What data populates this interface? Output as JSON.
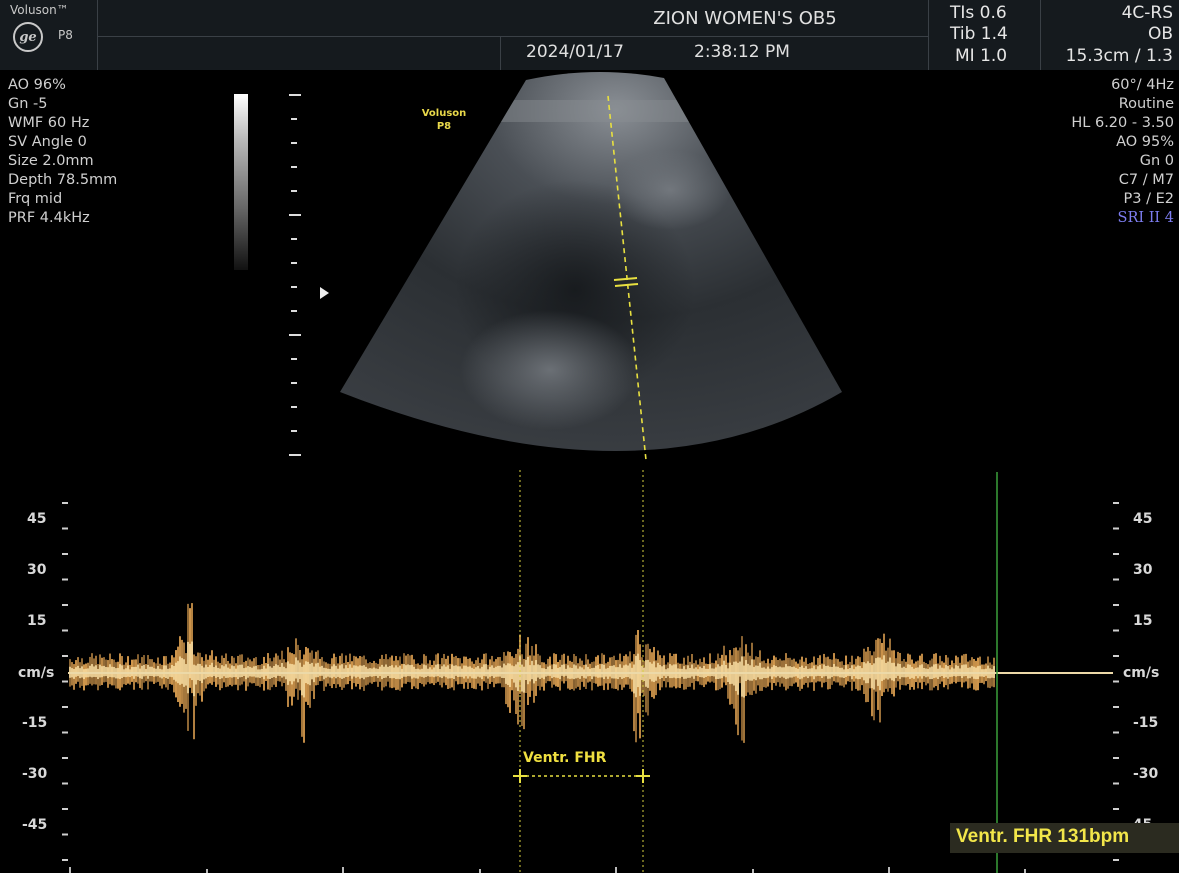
{
  "header": {
    "brand": "Voluson™",
    "probe": "P8",
    "institution": "ZION WOMEN'S OB5",
    "date": "2024/01/17",
    "time": "2:38:12 PM",
    "tis": "TIs 0.6",
    "tib": "Tib 1.4",
    "mi": "MI 1.0",
    "mode": "4C-RS",
    "preset": "OB",
    "depth_freq": "15.3cm / 1.3"
  },
  "left_params": [
    "AO 96%",
    "Gn -5",
    "WMF 60 Hz",
    "SV Angle 0",
    "Size 2.0mm",
    "Depth 78.5mm",
    "Frq mid",
    "PRF 4.4kHz"
  ],
  "right_params": [
    "60°/ 4Hz",
    "Routine",
    "HL 6.20 - 3.50",
    "AO 95%",
    "Gn 0",
    "C7 / M7",
    "P3 / E2",
    "SRI II 4"
  ],
  "watermark": {
    "line1": "Voluson",
    "line2": "P8"
  },
  "doppler": {
    "unit_left": "cm/s",
    "unit_right": "cm/s",
    "left_ticks": [
      "45",
      "30",
      "15",
      "-15",
      "-30",
      "-45"
    ],
    "right_ticks": [
      "45",
      "30",
      "15",
      "-15",
      "-30",
      "-45"
    ],
    "scale_values": [
      45,
      30,
      15,
      -15,
      -30,
      -45
    ],
    "measurement_label": "Ventr. FHR",
    "result": "Ventr. FHR 131bpm",
    "colors": {
      "spectrum": "#e8a855",
      "spectrum_core": "#fbe1a6",
      "baseline": "#ecd9a8",
      "sweep_line": "#3aa03a",
      "caliper": "#e8e040"
    }
  }
}
